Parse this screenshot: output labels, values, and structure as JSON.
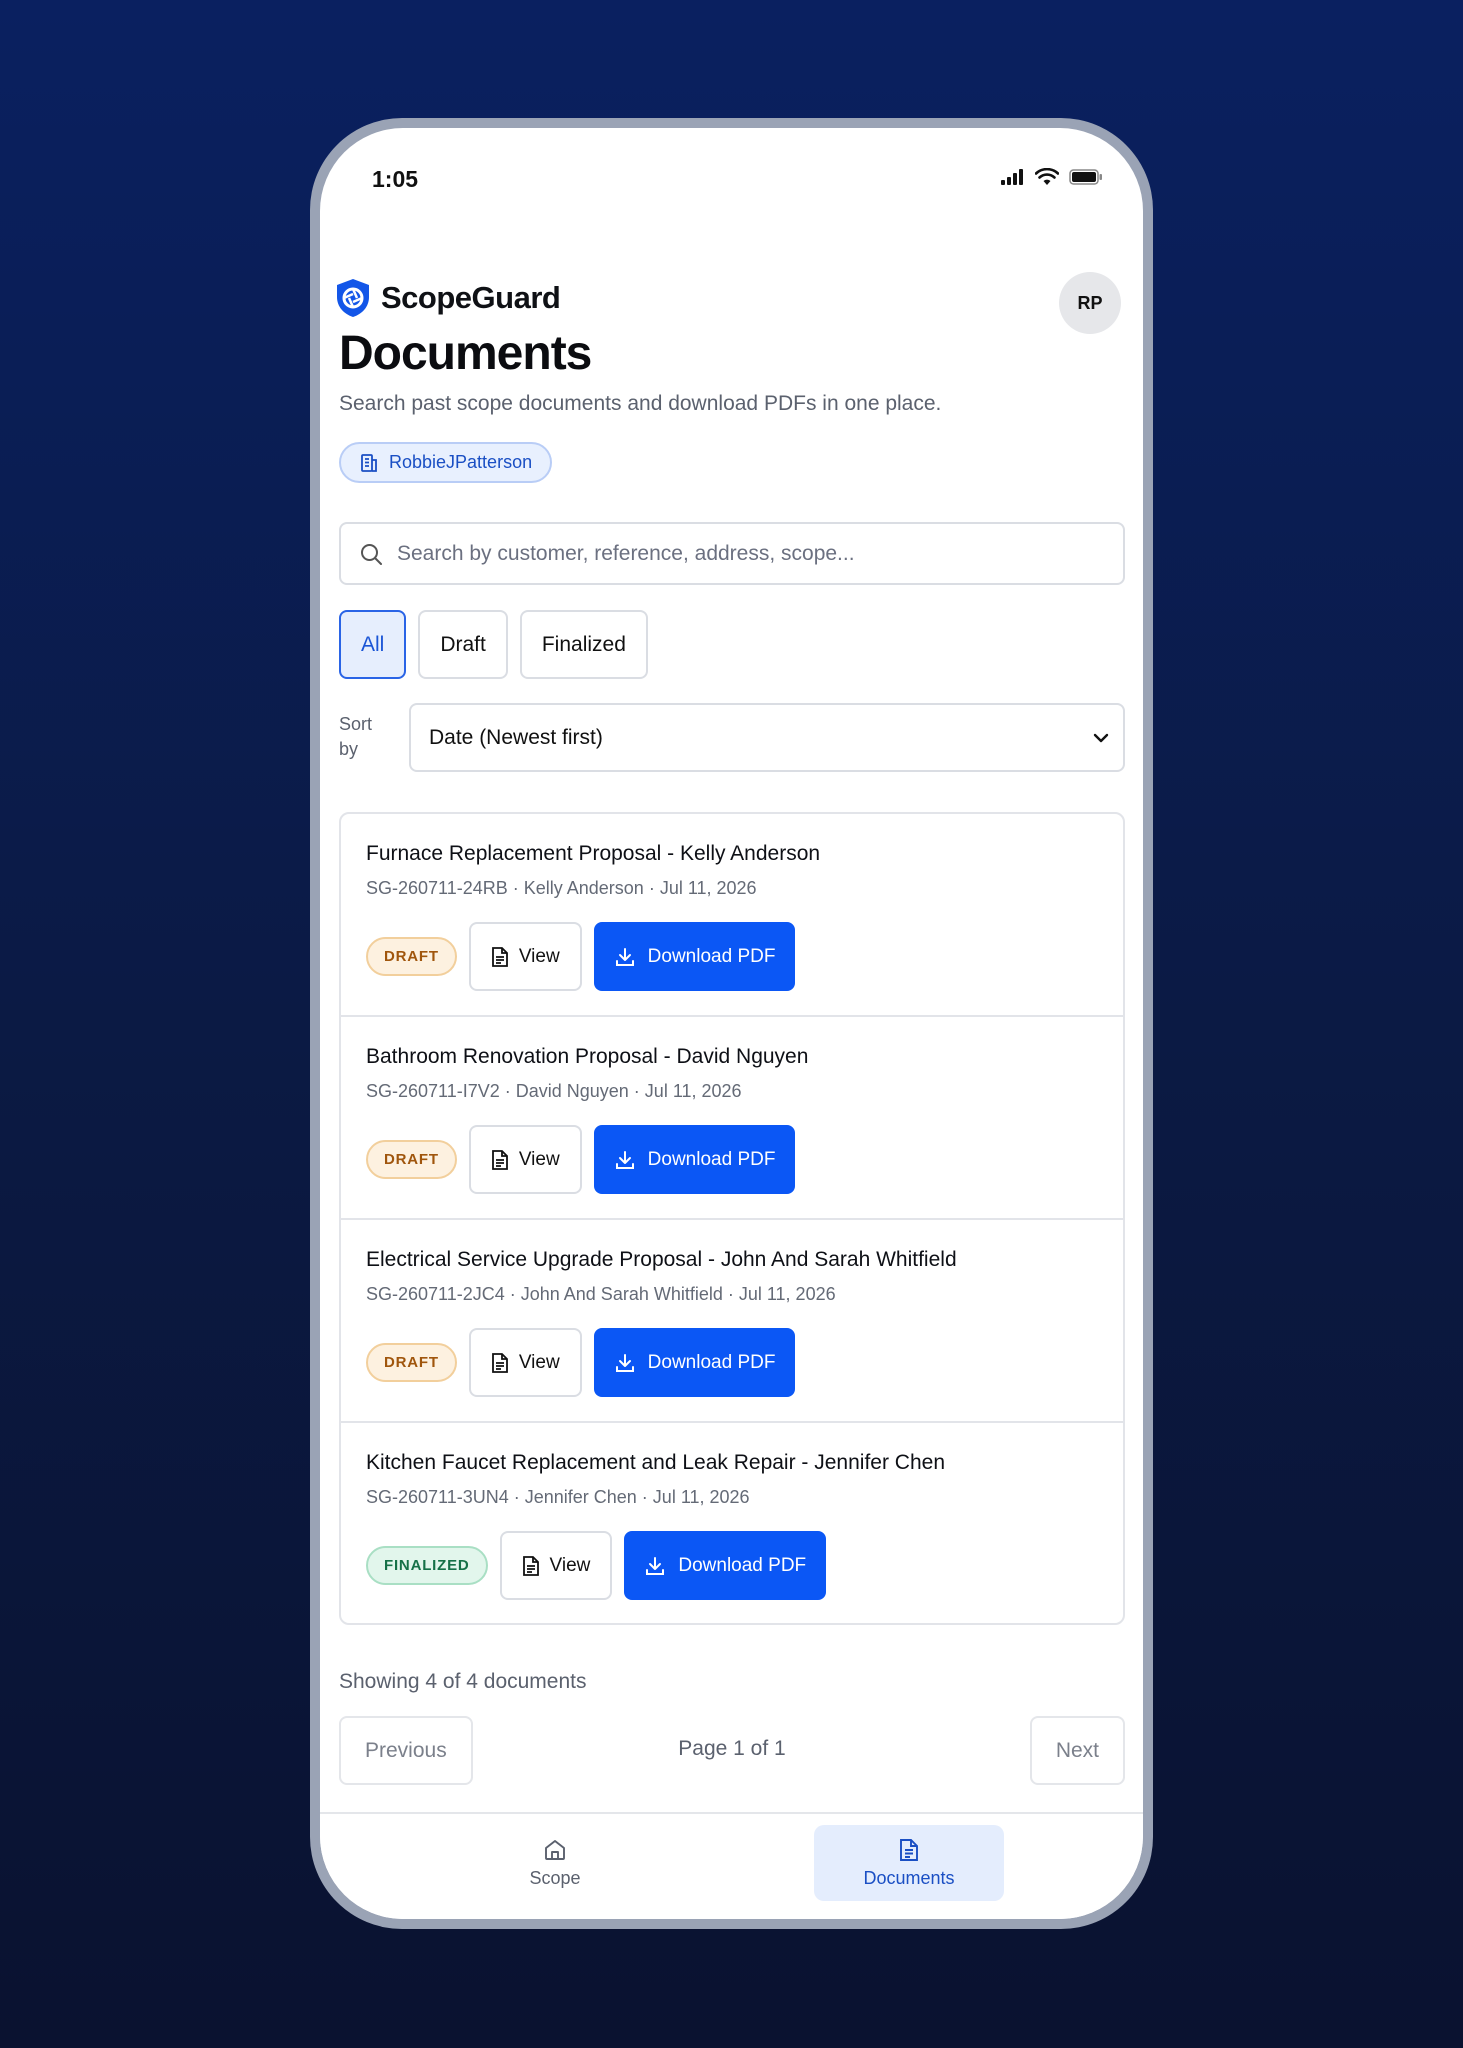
{
  "status_bar": {
    "time": "1:05"
  },
  "header": {
    "brand_name": "ScopeGuard",
    "avatar_initials": "RP"
  },
  "page": {
    "title": "Documents",
    "subtitle": "Search past scope documents and download PDFs in one place.",
    "org_name": "RobbieJPatterson"
  },
  "search": {
    "placeholder": "Search by customer, reference, address, scope...",
    "value": ""
  },
  "filters": {
    "all": "All",
    "draft": "Draft",
    "finalized": "Finalized",
    "active": "All"
  },
  "sort": {
    "label": "Sort by",
    "value": "Date (Newest first)"
  },
  "documents": [
    {
      "title": "Furnace Replacement Proposal - Kelly Anderson",
      "meta": "SG-260711-24RB · Kelly Anderson · Jul 11, 2026",
      "status": "DRAFT",
      "view_label": "View",
      "download_label": "Download PDF"
    },
    {
      "title": "Bathroom Renovation Proposal - David Nguyen",
      "meta": "SG-260711-I7V2 · David Nguyen · Jul 11, 2026",
      "status": "DRAFT",
      "view_label": "View",
      "download_label": "Download PDF"
    },
    {
      "title": "Electrical Service Upgrade Proposal - John And Sarah Whitfield",
      "meta": "SG-260711-2JC4 · John And Sarah Whitfield · Jul 11, 2026",
      "status": "DRAFT",
      "view_label": "View",
      "download_label": "Download PDF"
    },
    {
      "title": "Kitchen Faucet Replacement and Leak Repair - Jennifer Chen",
      "meta": "SG-260711-3UN4 · Jennifer Chen · Jul 11, 2026",
      "status": "FINALIZED",
      "view_label": "View",
      "download_label": "Download PDF"
    }
  ],
  "pagination": {
    "showing": "Showing 4 of 4 documents",
    "previous": "Previous",
    "page_label": "Page 1 of 1",
    "next": "Next"
  },
  "tabbar": {
    "scope": "Scope",
    "documents": "Documents",
    "active": "Documents"
  },
  "colors": {
    "primary": "#0b57f5",
    "draft_text": "#a0560d",
    "finalized_text": "#167148",
    "background": "#0b1a44"
  }
}
